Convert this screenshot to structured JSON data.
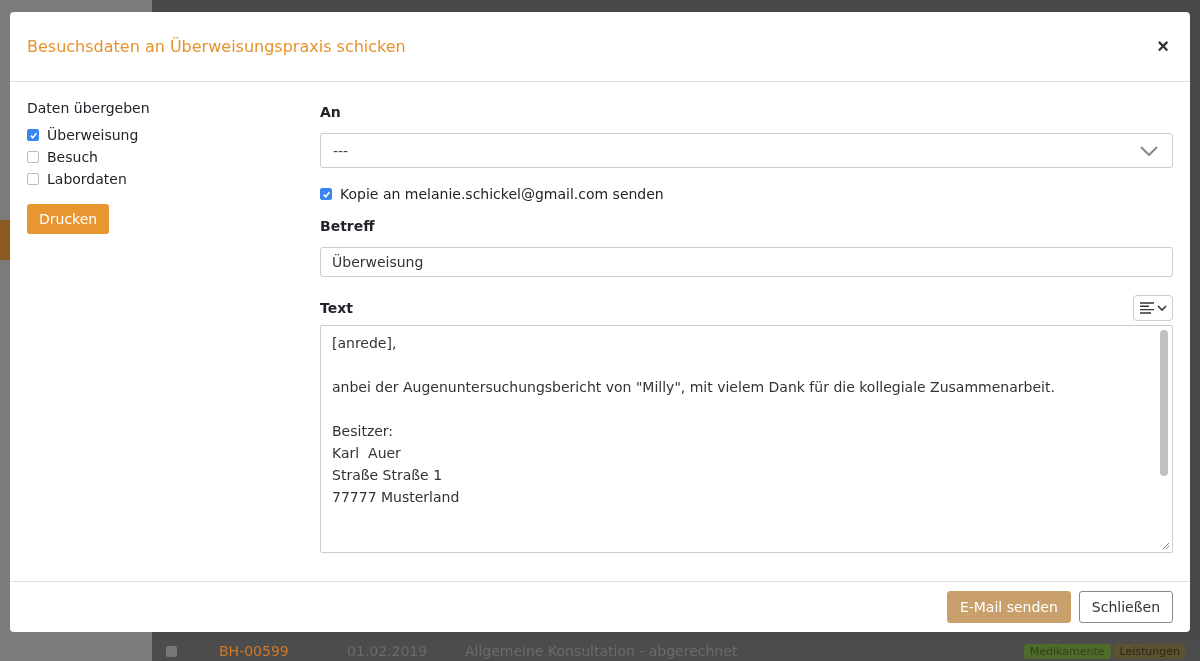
{
  "background": {
    "rows": [
      {
        "checked": false,
        "code": "BH-00599",
        "date": "01.02.2019",
        "title": "Allgemeine Konsultation - abgerechnet",
        "tags": [
          "Medikamente",
          "Leistungen"
        ]
      }
    ]
  },
  "dialog": {
    "title": "Besuchsdaten an Überweisungspraxis schicken",
    "close": "×",
    "transfer": {
      "heading": "Daten übergeben",
      "options": [
        {
          "label": "Überweisung",
          "checked": true
        },
        {
          "label": "Besuch",
          "checked": false
        },
        {
          "label": "Labordaten",
          "checked": false
        }
      ],
      "print_button": "Drucken"
    },
    "to": {
      "label": "An",
      "value": "---"
    },
    "copy": {
      "label": "Kopie an melanie.schickel@gmail.com senden",
      "checked": true
    },
    "subject": {
      "label": "Betreff",
      "value": "Überweisung"
    },
    "text": {
      "label": "Text",
      "value": "[anrede],\n\nanbei der Augenuntersuchungsbericht von \"Milly\", mit vielem Dank für die kollegiale Zusammenarbeit.\n\nBesitzer:\nKarl  Auer\nStraße Straße 1\n77777 Musterland"
    },
    "buttons": [
      {
        "label": "E-Mail senden",
        "kind": "primary"
      },
      {
        "label": "Schließen",
        "kind": "secondary"
      }
    ]
  }
}
